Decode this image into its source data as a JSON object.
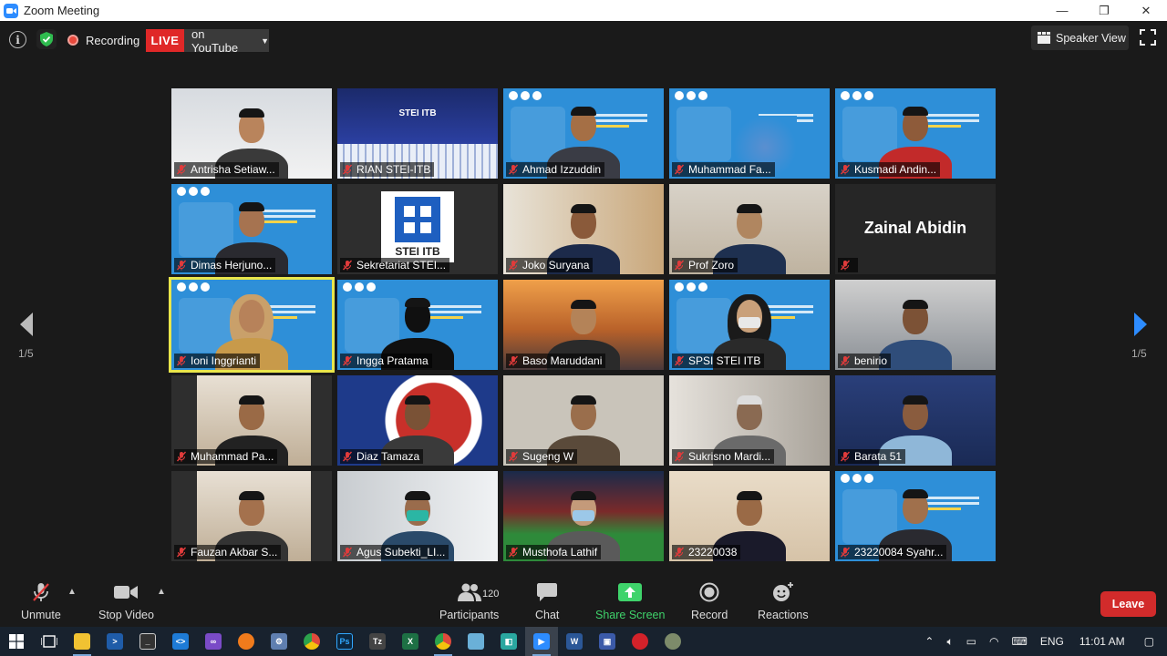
{
  "window": {
    "title": "Zoom Meeting",
    "minimize": "—",
    "restore": "❐",
    "close": "✕"
  },
  "topbar": {
    "recording_label": "Recording",
    "live_label": "LIVE",
    "live_target": "on YouTube",
    "view_label": "Speaker View"
  },
  "gallery": {
    "page_left": "1/5",
    "page_right": "1/5",
    "tiles": [
      {
        "name": "Antrisha Setiaw..."
      },
      {
        "name": "RIAN STEI-ITB",
        "overlay": "STEI ITB"
      },
      {
        "name": "Ahmad Izzuddin"
      },
      {
        "name": "Muhammad Fa..."
      },
      {
        "name": "Kusmadi Andin..."
      },
      {
        "name": "Dimas Herjuno..."
      },
      {
        "name": "Sekretariat STEI..."
      },
      {
        "name": "Joko Suryana"
      },
      {
        "name": "Prof Zoro"
      },
      {
        "name": "",
        "display_name": "Zainal Abidin"
      },
      {
        "name": "Ioni Inggrianti",
        "active": true
      },
      {
        "name": "Ingga Pratama"
      },
      {
        "name": "Baso Maruddani"
      },
      {
        "name": "SPSI STEI ITB"
      },
      {
        "name": "benirio"
      },
      {
        "name": "Muhammad Pa..."
      },
      {
        "name": "Diaz Tamaza"
      },
      {
        "name": "Sugeng W"
      },
      {
        "name": "Sukrisno Mardi..."
      },
      {
        "name": "Barata 51"
      },
      {
        "name": "Fauzan Akbar S..."
      },
      {
        "name": "Agus Subekti_LI..."
      },
      {
        "name": "Musthofa Lathif"
      },
      {
        "name": "23220038"
      },
      {
        "name": "23220084 Syahr..."
      }
    ]
  },
  "toolbar": {
    "unmute": "Unmute",
    "stop_video": "Stop Video",
    "participants": "Participants",
    "participants_count": "120",
    "chat": "Chat",
    "share_screen": "Share Screen",
    "record": "Record",
    "reactions": "Reactions",
    "leave": "Leave"
  },
  "taskbar": {
    "language": "ENG",
    "time": "11:01 AM"
  },
  "colors": {
    "live_red": "#e02828",
    "share_green": "#3fd36b",
    "leave_red": "#d22b2b",
    "active_speaker": "#e9e64b",
    "nav_arrow": "#2d8cff"
  }
}
